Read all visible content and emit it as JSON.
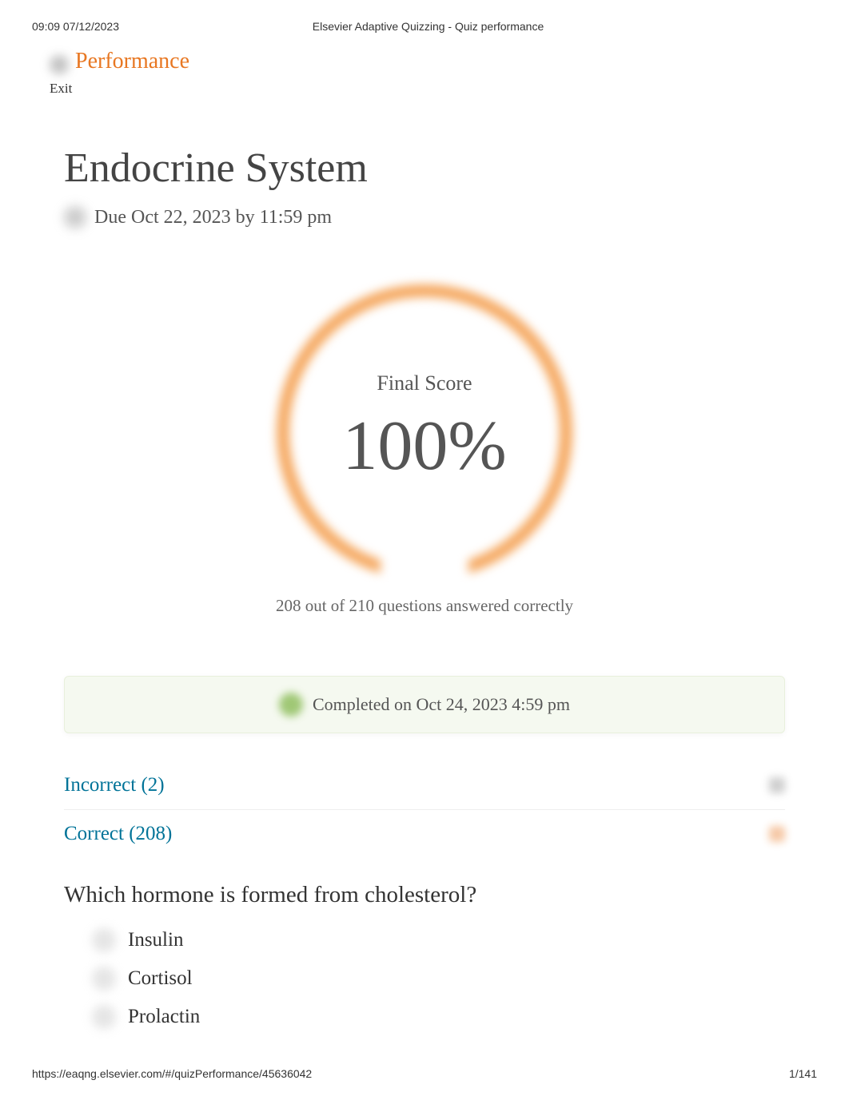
{
  "header": {
    "timestamp": "09:09 07/12/2023",
    "title": "Elsevier Adaptive Quizzing - Quiz performance"
  },
  "breadcrumb": {
    "label": "Performance"
  },
  "exit": {
    "label": "Exit"
  },
  "quiz": {
    "title": "Endocrine System",
    "due_date": "Due Oct 22, 2023 by 11:59 pm"
  },
  "score": {
    "label": "Final Score",
    "value": "100%",
    "summary": "208 out of 210 questions answered correctly"
  },
  "completed": {
    "text": "Completed on Oct 24, 2023 4:59 pm"
  },
  "sections": {
    "incorrect": "Incorrect (2)",
    "correct": "Correct (208)"
  },
  "question": {
    "text": "Which hormone is formed from cholesterol?",
    "answers": [
      "Insulin",
      "Cortisol",
      "Prolactin"
    ]
  },
  "footer": {
    "url": "https://eaqng.elsevier.com/#/quizPerformance/45636042",
    "page": "1/141"
  }
}
